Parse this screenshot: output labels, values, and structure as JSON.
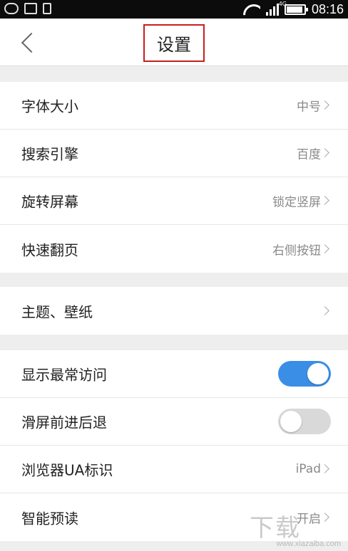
{
  "status_bar": {
    "time": "08:16",
    "network": "4G",
    "battery_level": 0.9,
    "icons": [
      "wechat-icon",
      "gallery-icon",
      "sim-icon",
      "wifi-icon",
      "signal-icon",
      "battery-icon"
    ]
  },
  "header": {
    "title": "设置",
    "back_icon": "chevron-left-icon",
    "highlight_color": "#c81e1e"
  },
  "groups": [
    {
      "rows": [
        {
          "label": "字体大小",
          "value": "中号"
        },
        {
          "label": "搜索引擎",
          "value": "百度"
        },
        {
          "label": "旋转屏幕",
          "value": "锁定竖屏"
        },
        {
          "label": "快速翻页",
          "value": "右侧按钮"
        }
      ]
    },
    {
      "rows": [
        {
          "label": "主题、壁纸",
          "value": ""
        }
      ]
    },
    {
      "rows": [
        {
          "label": "显示最常访问",
          "toggle": true
        },
        {
          "label": "滑屏前进后退",
          "toggle": false
        },
        {
          "label": "浏览器UA标识",
          "value": "iPad"
        },
        {
          "label": "智能预读",
          "value": "开启"
        }
      ]
    }
  ],
  "toggle_on_color": "#3a8ee6",
  "watermark": {
    "logo": "下载吧",
    "url": "www.xiazaiba.com"
  }
}
